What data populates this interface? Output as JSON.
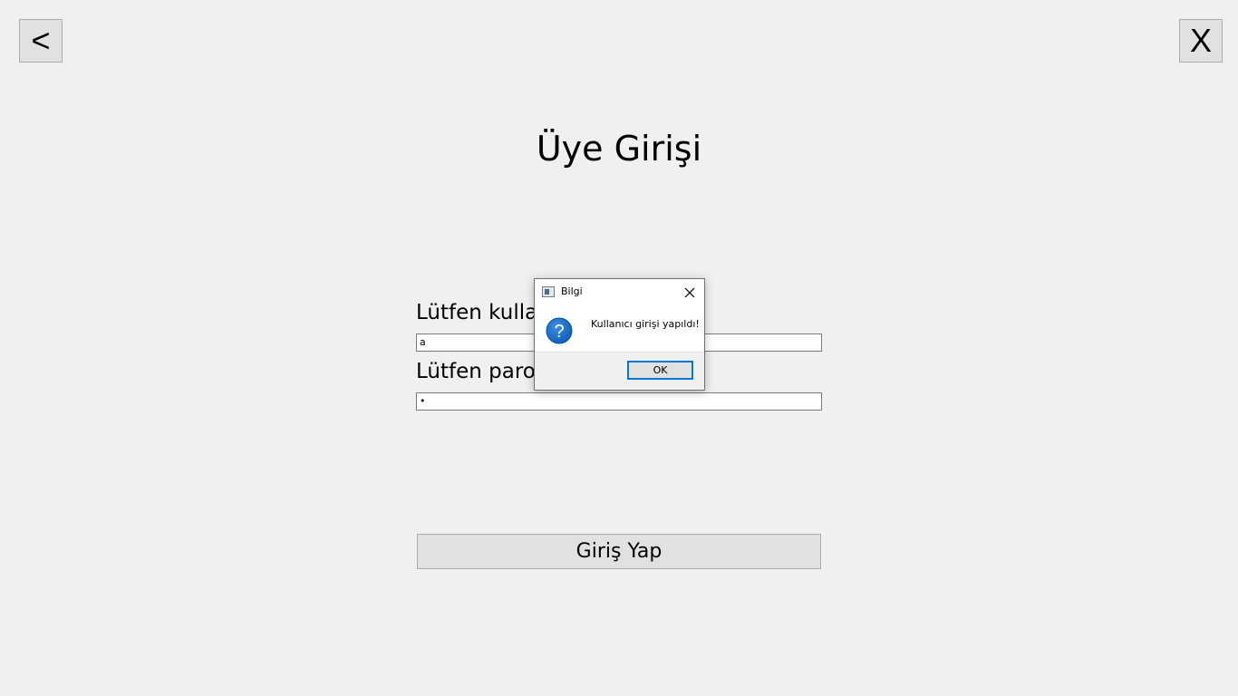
{
  "window": {
    "back_label": "<",
    "close_label": "X"
  },
  "login": {
    "title": "Üye Girişi",
    "username_label": "Lütfen kullan",
    "username_value": "a",
    "password_label": "Lütfen parol",
    "password_value": "•",
    "submit_label": "Giriş Yap"
  },
  "dialog": {
    "title": "Bilgi",
    "message": "Kullanıcı girişi yapıldı!",
    "ok_label": "OK",
    "icon": "question-icon",
    "accent_color": "#0078d7"
  }
}
